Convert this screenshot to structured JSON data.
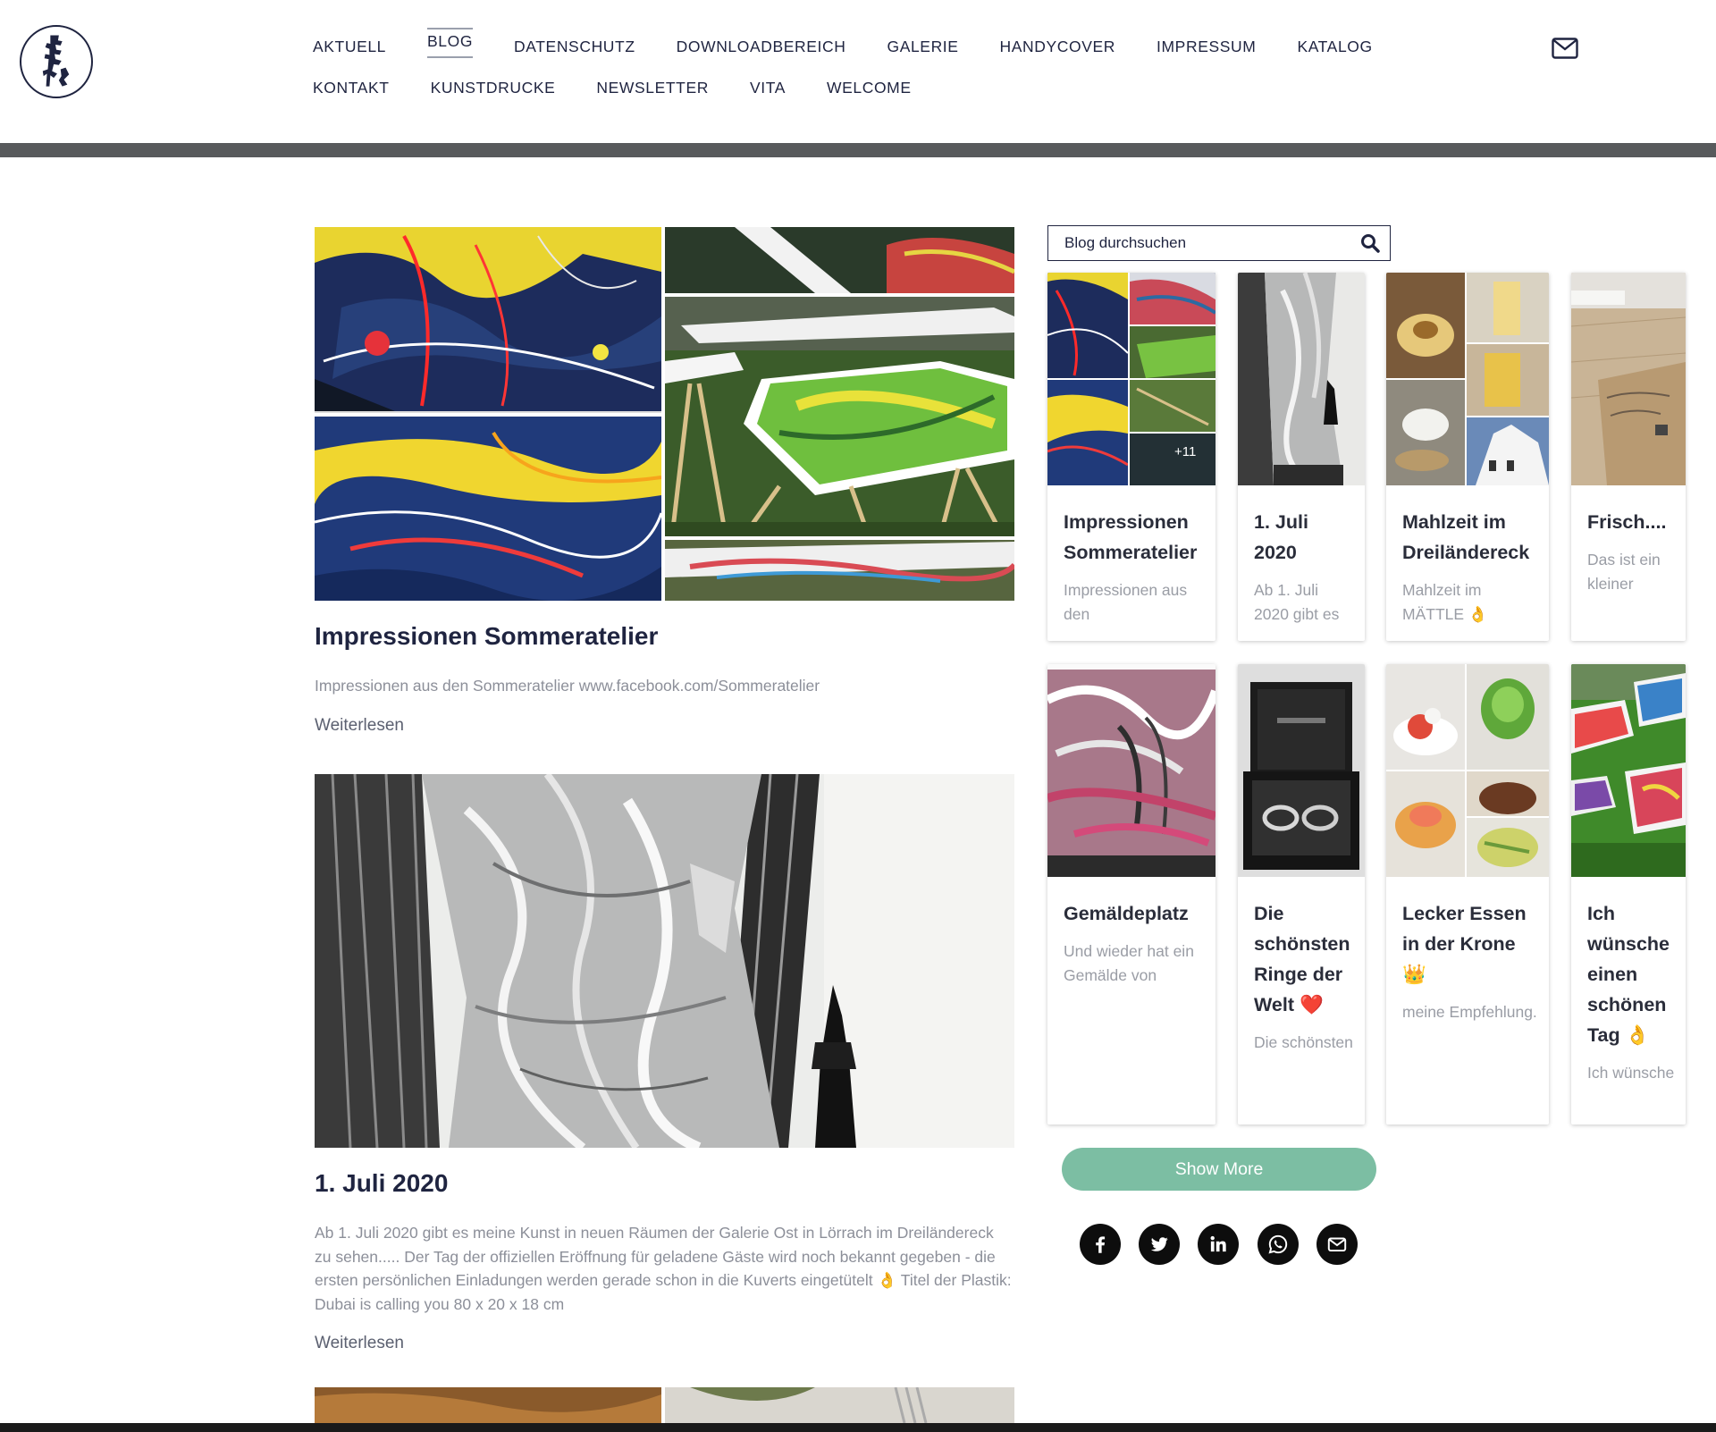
{
  "nav": {
    "row1": [
      "AKTUELL",
      "BLOG",
      "DATENSCHUTZ",
      "DOWNLOADBEREICH",
      "GALERIE",
      "HANDYCOVER",
      "IMPRESSUM",
      "KATALOG"
    ],
    "row2": [
      "KONTAKT",
      "KUNSTDRUCKE",
      "NEWSLETTER",
      "VITA",
      "WELCOME"
    ],
    "active": "BLOG"
  },
  "posts": [
    {
      "title": "Impressionen Sommeratelier",
      "excerpt": "Impressionen aus den Sommeratelier  www.facebook.com/Sommeratelier",
      "more": "Weiterlesen"
    },
    {
      "title": "1. Juli 2020",
      "excerpt": "Ab 1. Juli 2020 gibt es meine Kunst in neuen Räumen der Galerie Ost in Lörrach im Dreiländereck zu sehen..... Der Tag der offiziellen Eröffnung für geladene Gäste wird noch bekannt gegeben - die ersten persönlichen Einladungen werden gerade schon in die Kuverts eingetütelt 👌 Titel der Plastik: Dubai is calling you 80 x 20 x 18 cm",
      "more": "Weiterlesen"
    }
  ],
  "search": {
    "placeholder": "Blog durchsuchen"
  },
  "cards": [
    {
      "title": "Impressionen Sommeratelier",
      "excerpt": "Impressionen aus den",
      "badge": "+11"
    },
    {
      "title": "1. Juli 2020",
      "excerpt": "Ab 1. Juli 2020 gibt es"
    },
    {
      "title": "Mahlzeit im Dreiländereck",
      "excerpt": "Mahlzeit im MÄTTLE 👌"
    },
    {
      "title": "Frisch....",
      "excerpt": "Das ist ein kleiner"
    },
    {
      "title": "Gemäldeplatz",
      "excerpt": "Und wieder hat ein Gemälde von"
    },
    {
      "title": "Die schönsten Ringe der Welt ❤️",
      "excerpt": "Die schönsten"
    },
    {
      "title": "Lecker Essen in der Krone 👑",
      "excerpt": "meine Empfehlung."
    },
    {
      "title": "Ich wünsche einen schönen Tag 👌",
      "excerpt": "Ich wünsche"
    }
  ],
  "show_more": "Show More",
  "social": [
    "facebook-icon",
    "twitter-icon",
    "linkedin-icon",
    "whatsapp-icon",
    "email-icon"
  ],
  "colors": {
    "brand_navy": "#1f2440",
    "accent_green": "#7cbea3",
    "header_bar": "#585a5c"
  }
}
